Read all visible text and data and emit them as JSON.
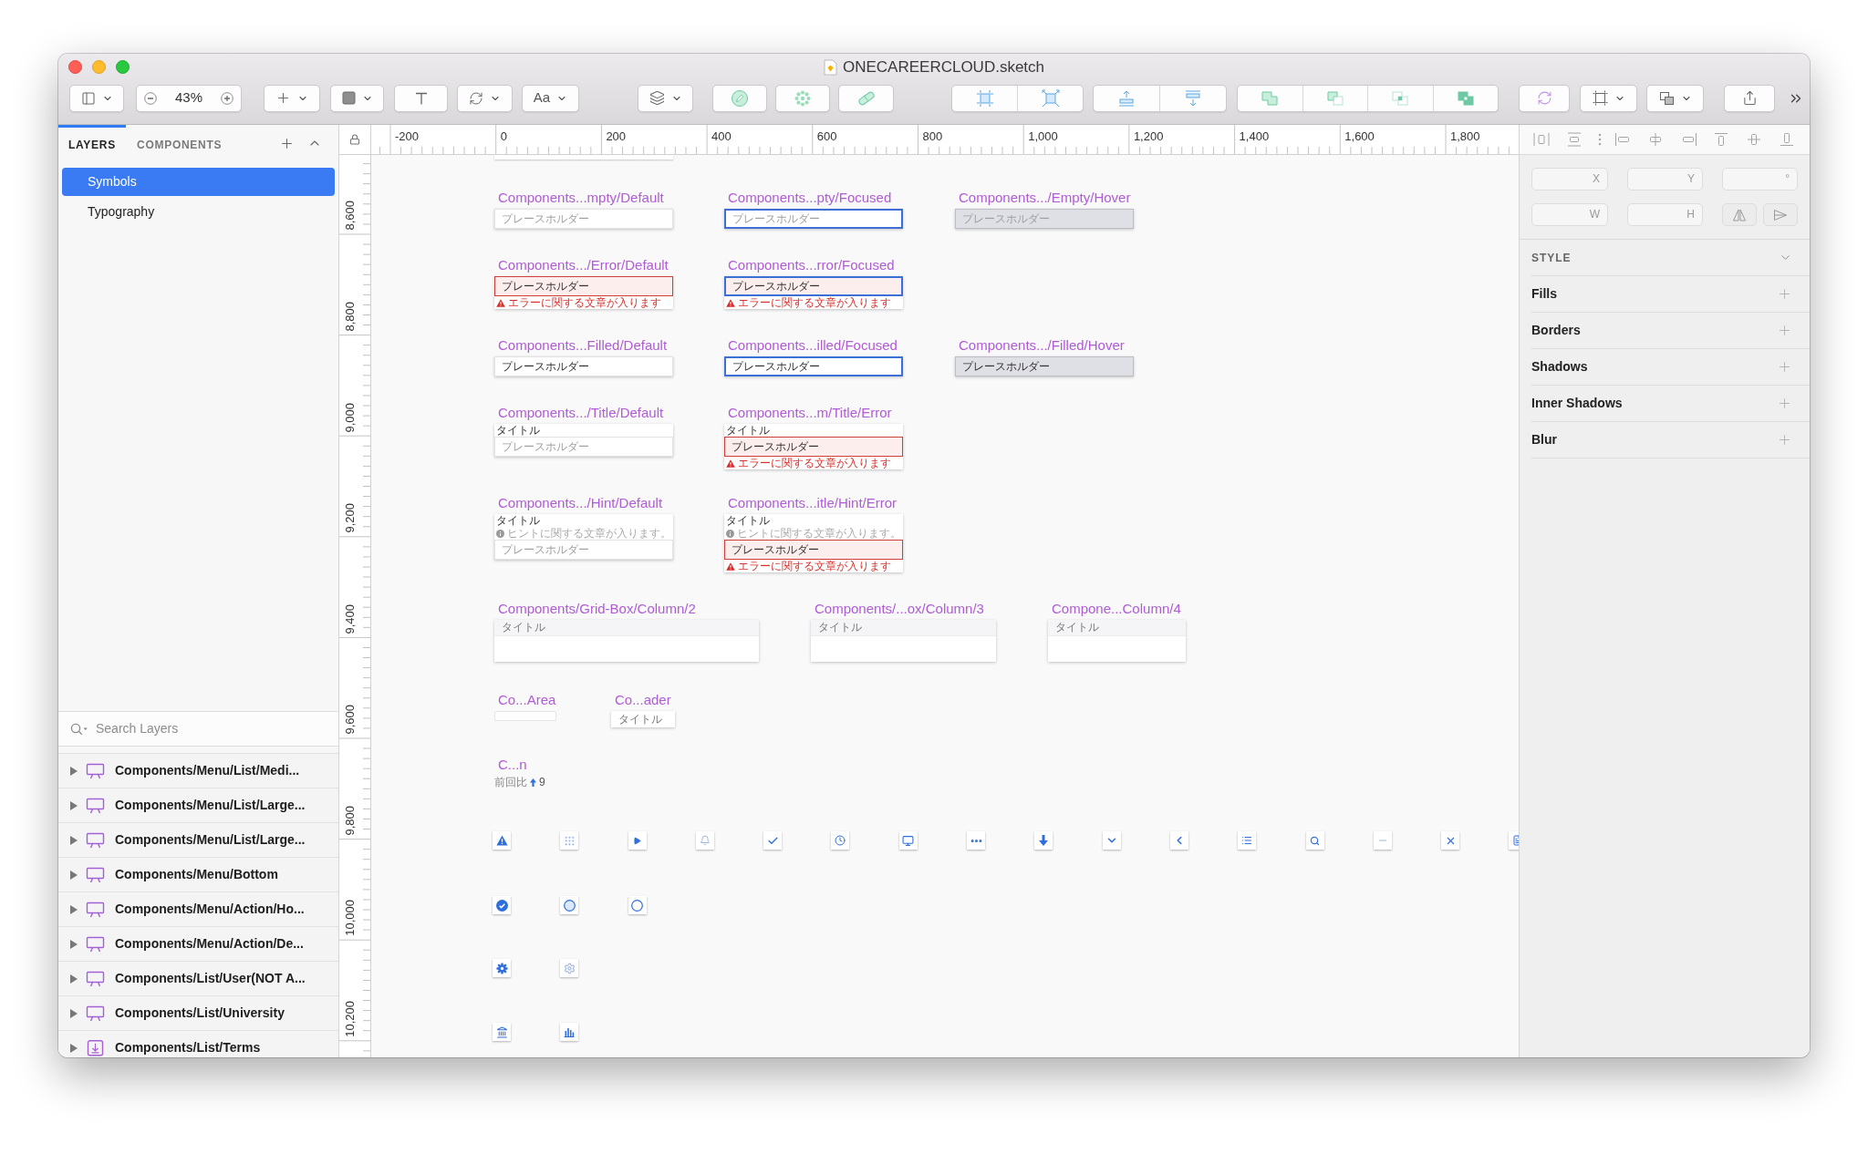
{
  "window": {
    "title": "ONECAREERCLOUD.sketch"
  },
  "toolbar": {
    "zoom": "43%",
    "text_style": "Aa"
  },
  "layers_panel": {
    "tabs": [
      {
        "label": "LAYERS",
        "selected": true
      },
      {
        "label": "COMPONENTS",
        "selected": false
      }
    ],
    "pages": [
      {
        "label": "Symbols",
        "selected": true
      },
      {
        "label": "Typography",
        "selected": false
      }
    ],
    "search": {
      "placeholder": "Search Layers"
    },
    "layers": [
      {
        "name": "Components/Menu/List/Medi...",
        "kind": "symbol",
        "expanded": false
      },
      {
        "name": "Components/Menu/List/Large...",
        "kind": "symbol",
        "expanded": false
      },
      {
        "name": "Components/Menu/List/Large...",
        "kind": "symbol",
        "expanded": false
      },
      {
        "name": "Components/Menu/Bottom",
        "kind": "symbol",
        "expanded": false
      },
      {
        "name": "Components/Menu/Action/Ho...",
        "kind": "symbol",
        "expanded": false
      },
      {
        "name": "Components/Menu/Action/De...",
        "kind": "symbol",
        "expanded": false
      },
      {
        "name": "Components/List/User(NOT A...",
        "kind": "symbol",
        "expanded": false
      },
      {
        "name": "Components/List/University",
        "kind": "symbol",
        "expanded": false
      },
      {
        "name": "Components/List/Terms",
        "kind": "library",
        "expanded": false
      }
    ]
  },
  "rulers": {
    "horizontal": [
      "-200",
      "0",
      "200",
      "400",
      "600",
      "800",
      "1,000",
      "1,200",
      "1,400",
      "1,600",
      "1,800"
    ],
    "vertical": [
      "8,600",
      "8,800",
      "9,000",
      "9,200",
      "9,400",
      "9,600",
      "9,800",
      "10,000",
      "10,200"
    ]
  },
  "canvas": {
    "input_symbols": [
      {
        "label": "Components...mpty/Default",
        "placeholder": "プレースホルダー",
        "focused": false,
        "hovered": false
      },
      {
        "label": "Components...pty/Focused",
        "placeholder": "プレースホルダー",
        "focused": true,
        "hovered": false
      },
      {
        "label": "Components.../Empty/Hover",
        "placeholder": "プレースホルダー",
        "focused": false,
        "hovered": true
      },
      {
        "label": "Components.../Error/Default",
        "value": "プレースホルダー",
        "error": "エラーに関する文章が入ります",
        "focused": false,
        "hovered": false
      },
      {
        "label": "Components...rror/Focused",
        "value": "プレースホルダー",
        "error": "エラーに関する文章が入ります",
        "focused": true,
        "hovered": false
      },
      {
        "label": "Components...Filled/Default",
        "value": "プレースホルダー",
        "focused": false,
        "hovered": false
      },
      {
        "label": "Components...illed/Focused",
        "value": "プレースホルダー",
        "focused": true,
        "hovered": false
      },
      {
        "label": "Components.../Filled/Hover",
        "value": "プレースホルダー",
        "focused": false,
        "hovered": true
      },
      {
        "label": "Components.../Title/Default",
        "title": "タイトル",
        "placeholder": "プレースホルダー",
        "focused": false,
        "hovered": false
      },
      {
        "label": "Components...m/Title/Error",
        "title": "タイトル",
        "value": "プレースホルダー",
        "error": "エラーに関する文章が入ります",
        "focused": false,
        "hovered": false
      },
      {
        "label": "Components.../Hint/Default",
        "title": "タイトル",
        "hint": "ヒントに関する文章が入ります。",
        "placeholder": "プレースホルダー",
        "focused": false,
        "hovered": false
      },
      {
        "label": "Components...itle/Hint/Error",
        "title": "タイトル",
        "hint": "ヒントに関する文章が入ります。",
        "value": "プレースホルダー",
        "error": "エラーに関する文章が入ります",
        "focused": false,
        "hovered": false
      }
    ],
    "grid_symbols": [
      {
        "label": "Components/Grid-Box/Column/2",
        "title": "タイトル"
      },
      {
        "label": "Components/...ox/Column/3",
        "title": "タイトル"
      },
      {
        "label": "Compone...Column/4",
        "title": "タイトル"
      }
    ],
    "other_symbols": [
      {
        "label": "Co...Area",
        "kind": "area"
      },
      {
        "label": "Co...ader",
        "kind": "header",
        "title": "タイトル"
      },
      {
        "label": "C...n",
        "kind": "comparison",
        "caption": "前回比",
        "value": "9"
      }
    ]
  },
  "inspector": {
    "fields": [
      {
        "label": "X"
      },
      {
        "label": "Y"
      },
      {
        "label": "°"
      },
      {
        "label": "W"
      },
      {
        "label": "H"
      }
    ],
    "style_title": "STYLE",
    "sections": [
      "Fills",
      "Borders",
      "Shadows",
      "Inner Shadows",
      "Blur"
    ]
  }
}
